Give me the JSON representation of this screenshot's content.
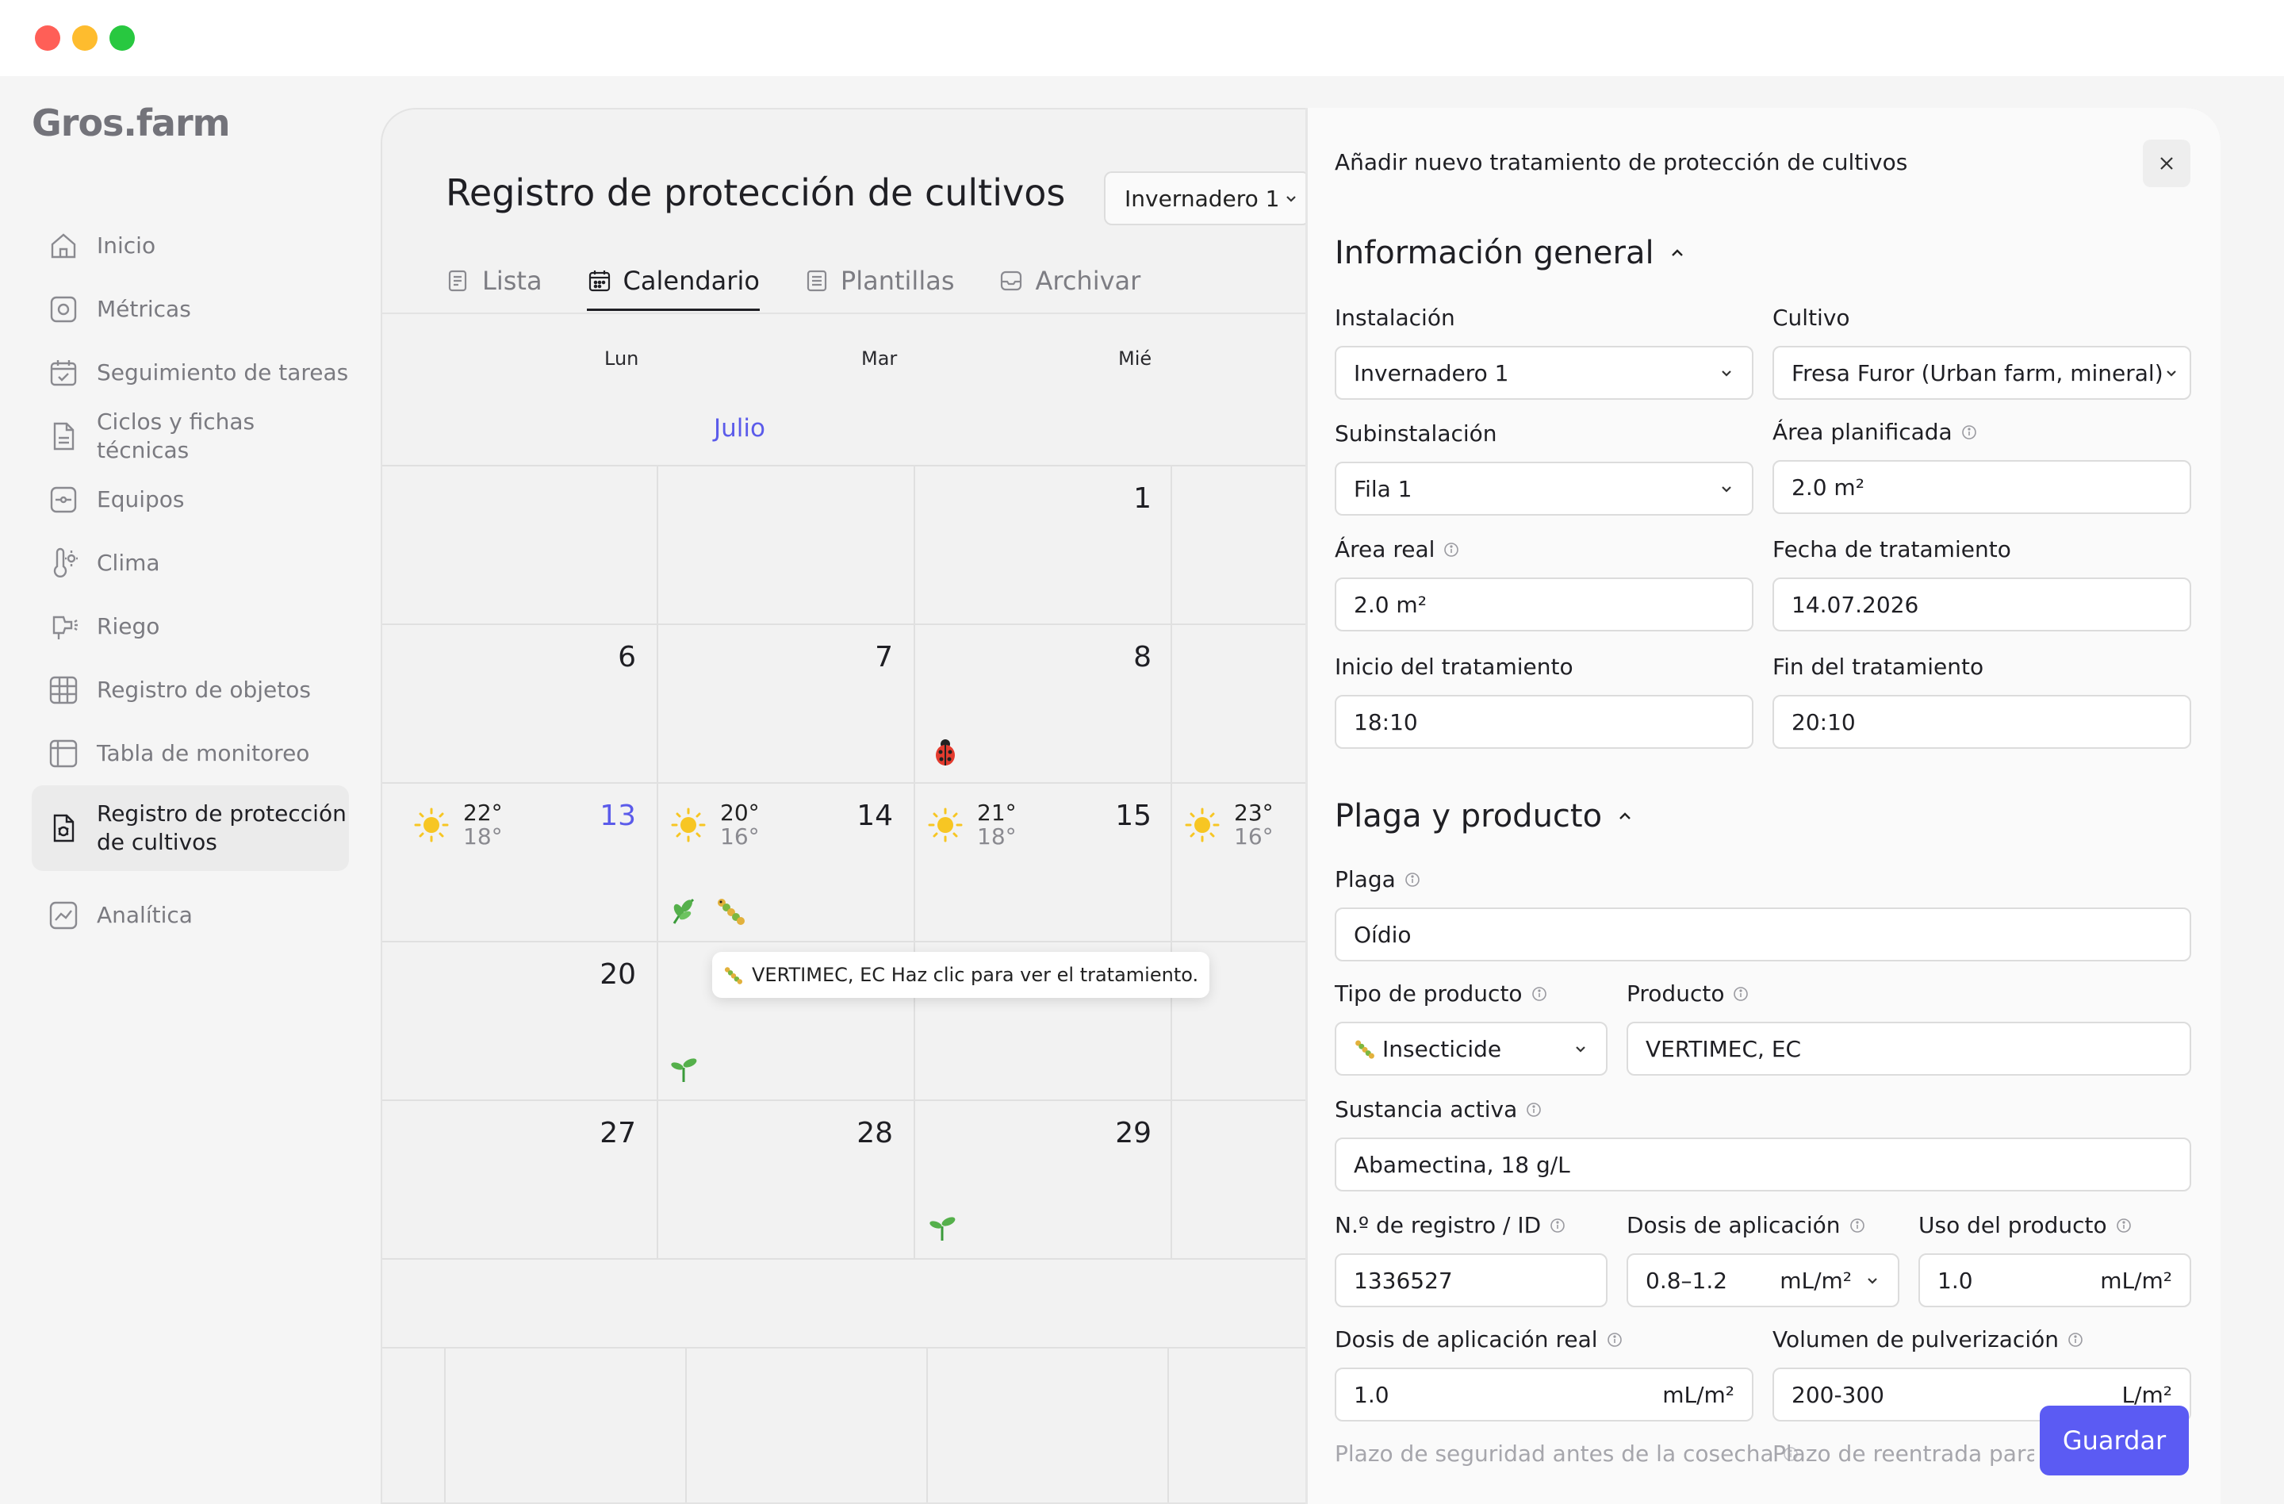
{
  "app": {
    "logo": "Gros.farm"
  },
  "sidebar": {
    "items": [
      {
        "label": "Inicio",
        "icon": "home-icon"
      },
      {
        "label": "Métricas",
        "icon": "metrics-icon"
      },
      {
        "label": "Seguimiento de tareas",
        "icon": "tasks-icon"
      },
      {
        "label": "Ciclos y fichas técnicas",
        "icon": "document-icon"
      },
      {
        "label": "Equipos",
        "icon": "equipment-icon"
      },
      {
        "label": "Clima",
        "icon": "thermometer-icon"
      },
      {
        "label": "Riego",
        "icon": "irrigation-icon"
      },
      {
        "label": "Registro de objetos",
        "icon": "grid-icon"
      },
      {
        "label": "Tabla de monitoreo",
        "icon": "table-icon"
      },
      {
        "label": "Registro de protección\nde cultivos",
        "icon": "protection-icon",
        "active": true
      },
      {
        "label": "Analítica",
        "icon": "analytics-icon"
      }
    ]
  },
  "calendar": {
    "title": "Registro de protección de cultivos",
    "facility": "Invernadero 1",
    "tabs": [
      {
        "label": "Lista",
        "icon": "list-icon"
      },
      {
        "label": "Calendario",
        "icon": "calendar-icon",
        "active": true
      },
      {
        "label": "Plantillas",
        "icon": "templates-icon"
      },
      {
        "label": "Archivar",
        "icon": "archive-icon"
      }
    ],
    "weekdays": [
      "Lun",
      "Mar",
      "Mié"
    ],
    "month": "Julio",
    "days": {
      "d1": "1",
      "d6": "6",
      "d7": "7",
      "d8": "8",
      "d13": "13",
      "d14": "14",
      "d15": "15",
      "d20": "20",
      "d27": "27",
      "d28": "28",
      "d29": "29"
    },
    "weather": [
      {
        "hi": "22°",
        "lo": "18°"
      },
      {
        "hi": "20°",
        "lo": "16°"
      },
      {
        "hi": "21°",
        "lo": "18°"
      },
      {
        "hi": "23°",
        "lo": "16°"
      }
    ],
    "tooltip": "VERTIMEC, EC Haz clic para ver el tratamiento."
  },
  "drawer": {
    "title": "Añadir nuevo tratamiento de protección de cultivos",
    "general": {
      "heading": "Información general",
      "instalacion_label": "Instalación",
      "instalacion": "Invernadero 1",
      "cultivo_label": "Cultivo",
      "cultivo": "Fresa Furor (Urban farm, mineral)",
      "subinstalacion_label": "Subinstalación",
      "subinstalacion": "Fila 1",
      "area_plan_label": "Área planificada",
      "area_plan": "2.0 m²",
      "area_real_label": "Área real",
      "area_real": "2.0 m²",
      "fecha_label": "Fecha de tratamiento",
      "fecha": "14.07.2026",
      "inicio_label": "Inicio del tratamiento",
      "inicio": "18:10",
      "fin_label": "Fin del tratamiento",
      "fin": "20:10"
    },
    "pest": {
      "heading": "Plaga y producto",
      "plaga_label": "Plaga",
      "plaga": "Oídio",
      "tipo_label": "Tipo de producto",
      "tipo": "Insecticide",
      "producto_label": "Producto",
      "producto": "VERTIMEC, EC",
      "sustancia_label": "Sustancia activa",
      "sustancia": "Abamectina, 18 g/L",
      "registro_label": "N.º de registro / ID",
      "registro": "1336527",
      "dosis_label": "Dosis de aplicación",
      "dosis": "0.8–1.2",
      "dosis_unit": "mL/m²",
      "uso_label": "Uso del producto",
      "uso": "1.0",
      "uso_unit": "mL/m²",
      "dosis_real_label": "Dosis de aplicación real",
      "dosis_real": "1.0",
      "dosis_real_unit": "mL/m²",
      "volumen_label": "Volumen de pulverización",
      "volumen": "200-300",
      "volumen_unit": "L/m²",
      "plazo_cosecha_label": "Plazo de seguridad antes de la cosecha",
      "plazo_reentrada_label": "Plazo de reentrada para tr"
    },
    "save_label": "Guardar"
  },
  "colors": {
    "accent": "#5b5bf3",
    "today": "#5b5bea"
  }
}
